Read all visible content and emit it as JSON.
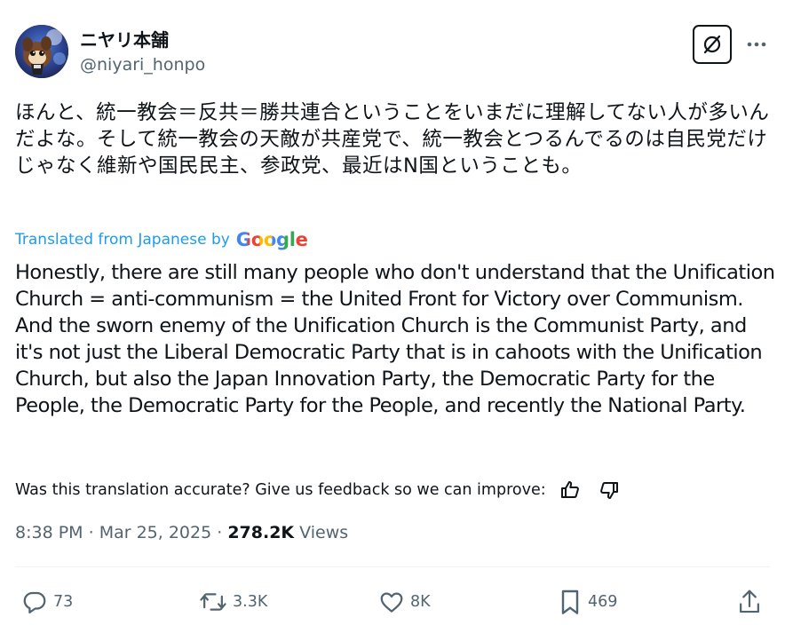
{
  "author": {
    "display_name": "ニヤリ本舗",
    "handle": "@niyari_honpo"
  },
  "tweet": {
    "original_text": "ほんと、統一教会＝反共＝勝共連合ということをいまだに理解してない人が多いんだよな。そして統一教会の天敵が共産党で、統一教会とつるんでるのは自民党だけじゃなく維新や国民民主、参政党、最近はN国ということも。",
    "translated_by_label": "Translated from Japanese by",
    "translator_logo": "Google",
    "translated_text": "Honestly, there are still many people who don't understand that the Unification Church = anti-communism = the United Front for Victory over Communism. And the sworn enemy of the Unification Church is the Communist Party, and it's not just the Liberal Democratic Party that is in cahoots with the Unification Church, but also the Japan Innovation Party, the Democratic Party for the People, the Democratic Party for the People, and recently the National Party.",
    "feedback_prompt": "Was this translation accurate? Give us feedback so we can improve:",
    "time": "8:38 PM",
    "sep1": " · ",
    "date": "Mar 25, 2025",
    "sep2": " · ",
    "views_count": "278.2K",
    "views_label": " Views"
  },
  "actions": {
    "replies": "73",
    "reposts": "3.3K",
    "likes": "8K",
    "bookmarks": "469"
  },
  "icons": {
    "grok": "grok-icon",
    "more": "more-icon",
    "thumbs_up": "thumbs-up-icon",
    "thumbs_down": "thumbs-down-icon",
    "reply": "reply-icon",
    "repost": "repost-icon",
    "like": "like-icon",
    "bookmark": "bookmark-icon",
    "share": "share-icon"
  },
  "colors": {
    "link_blue": "#1d9bf0",
    "secondary_text": "#536471",
    "primary_text": "#0f1419",
    "google_blue": "#4285F4",
    "google_red": "#EA4335",
    "google_yellow": "#FBBC05",
    "google_green": "#34A853"
  }
}
